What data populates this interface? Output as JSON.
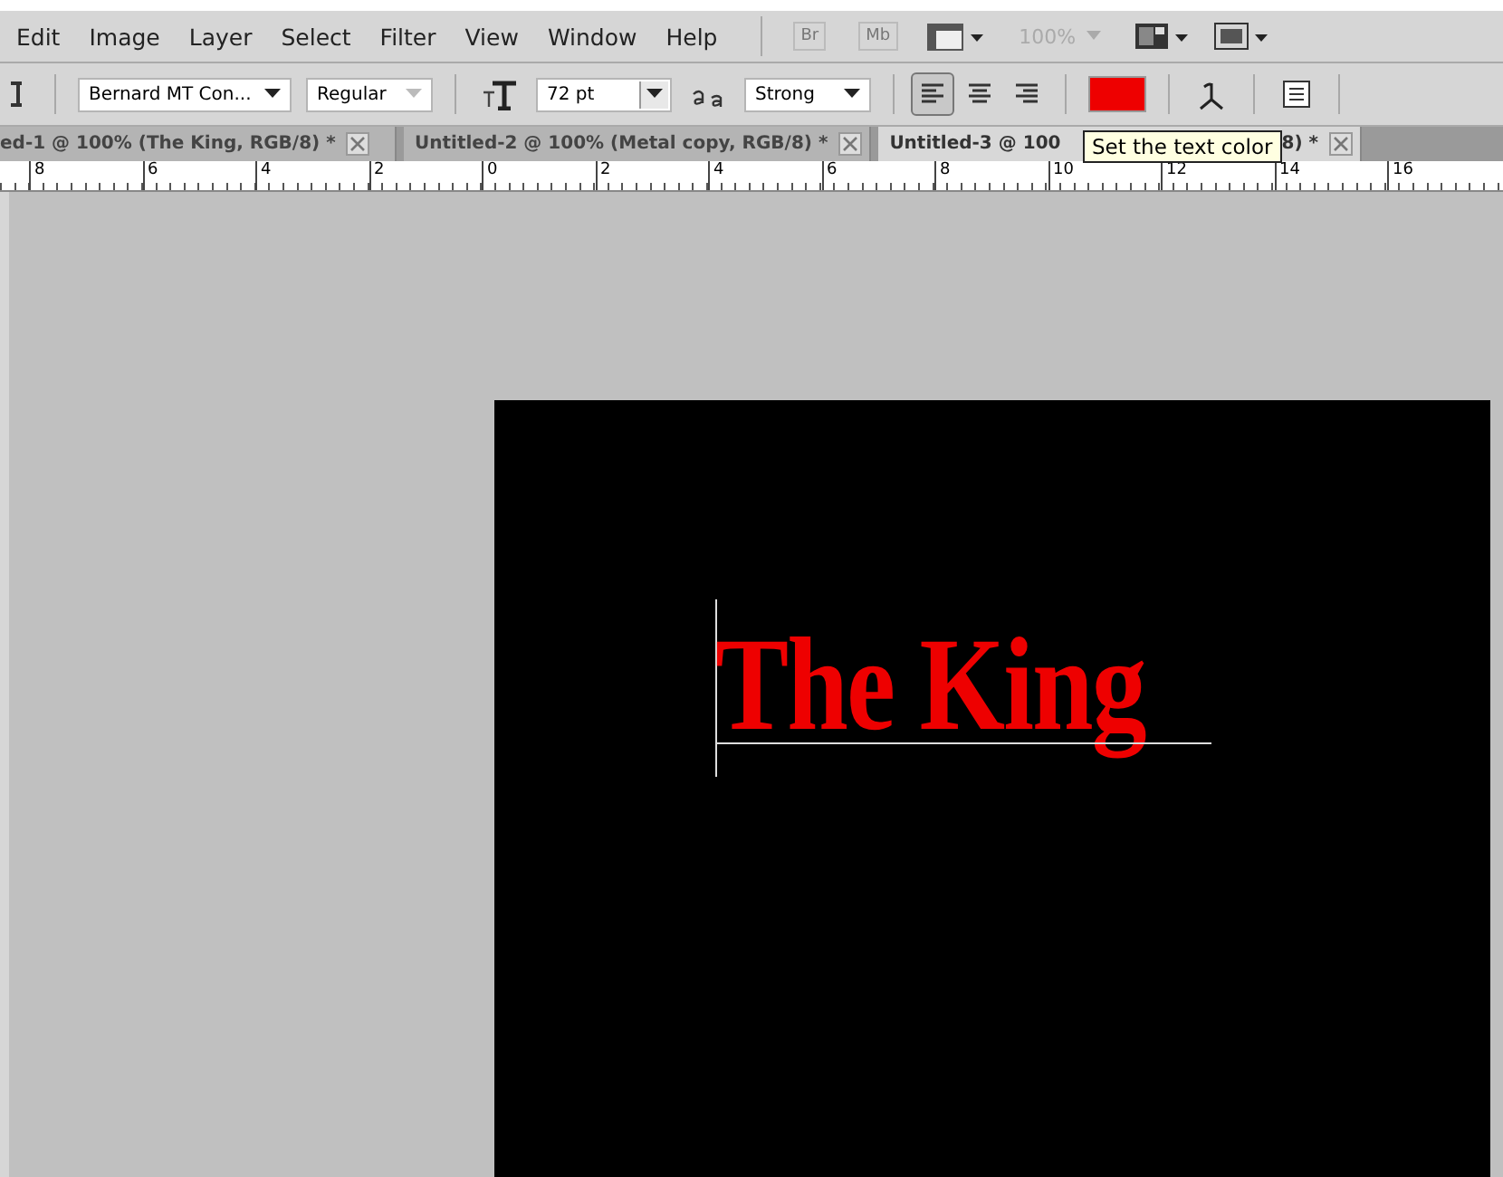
{
  "menu": [
    "Edit",
    "Image",
    "Layer",
    "Select",
    "Filter",
    "View",
    "Window",
    "Help"
  ],
  "app_bar": {
    "bridge": "Br",
    "mini_bridge": "Mb",
    "zoom": "100%"
  },
  "options": {
    "font_family": "Bernard MT Con...",
    "font_style": "Regular",
    "font_size": "72 pt",
    "antialias": "Strong",
    "color": "#ee0000",
    "alignment": [
      {
        "kind": "left",
        "selected": true
      },
      {
        "kind": "center",
        "selected": false
      },
      {
        "kind": "right",
        "selected": false
      }
    ]
  },
  "tabs": [
    {
      "parts": [
        "ed-1 @ 100% (The King, RGB/8) *"
      ],
      "selected": false
    },
    {
      "parts": [
        "Untitled-2 @ 100% (Metal copy, RGB/8) *"
      ],
      "selected": false
    },
    {
      "parts": [
        "Untitled-3 @ 100",
        "8) *"
      ],
      "selected": true
    }
  ],
  "tooltip": "Set the text color",
  "ruler": [
    "8",
    "6",
    "4",
    "2",
    "0",
    "2",
    "4",
    "6",
    "8",
    "10",
    "12",
    "14",
    "16"
  ],
  "canvas": {
    "text": "The King"
  }
}
